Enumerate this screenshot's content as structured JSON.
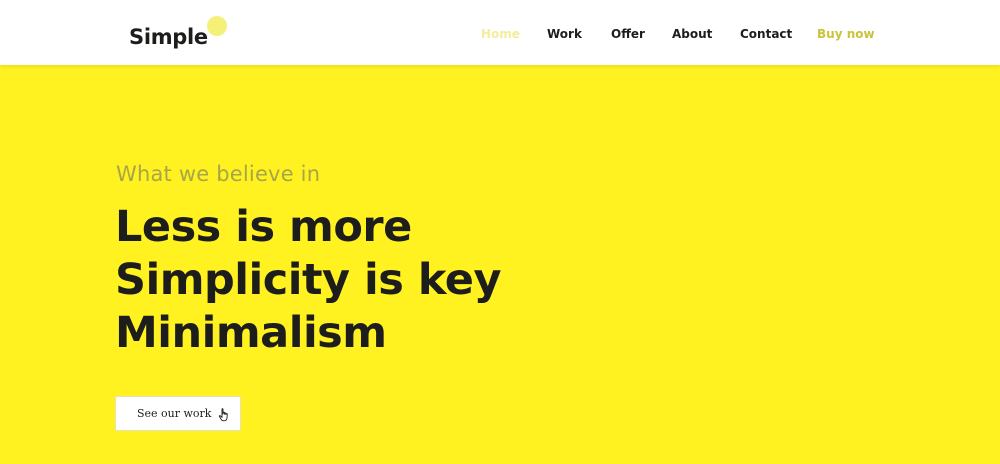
{
  "brand": {
    "name": "Simple",
    "accent_dot_color": "#f5f078"
  },
  "nav": {
    "items": [
      {
        "label": "Home",
        "state": "active"
      },
      {
        "label": "Work"
      },
      {
        "label": "Offer"
      },
      {
        "label": "About"
      },
      {
        "label": "Contact"
      },
      {
        "label": "Buy now"
      }
    ]
  },
  "hero": {
    "background_color": "#fff220",
    "eyebrow": "What we believe in",
    "headline_lines": [
      "Less is more",
      "Simplicity is key",
      "Minimalism"
    ],
    "cta": {
      "label": "See our work",
      "icon": "pointer-hand-icon"
    }
  },
  "colors": {
    "text_dark": "#1d1d1b",
    "nav_active": "#f1ee9c",
    "nav_buy_now": "#c8c43c",
    "eyebrow": "#a8a548"
  }
}
